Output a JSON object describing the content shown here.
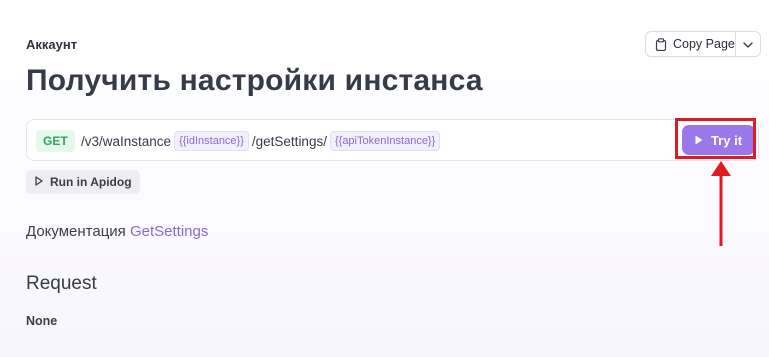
{
  "breadcrumb": "Аккаунт",
  "copy_page": {
    "label": "Copy Page",
    "icon": "clipboard-icon",
    "dropdown_icon": "chevron-down-icon"
  },
  "title": "Получить настройки инстанса",
  "endpoint": {
    "method": "GET",
    "segments": {
      "s1": "/v3/waInstance",
      "v1": "{{idInstance}}",
      "s2": "/getSettings/",
      "v2": "{{apiTokenInstance}}"
    },
    "try_button": "Try it"
  },
  "run_in_apidog": "Run in Apidog",
  "documentation": {
    "prefix": "Документация",
    "link": "GetSettings"
  },
  "request": {
    "heading": "Request",
    "body": "None"
  },
  "colors": {
    "accent": "#9a78ec",
    "method_get": "#2fa562",
    "annotation": "#e01a22"
  }
}
